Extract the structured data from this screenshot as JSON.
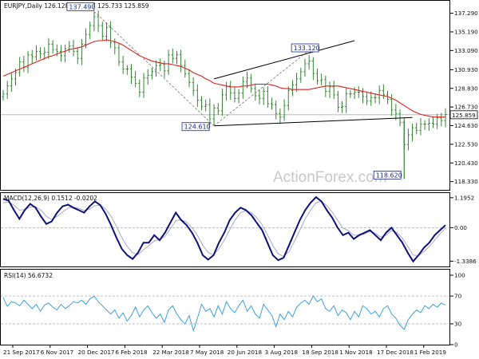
{
  "chart_data": [
    {
      "type": "candlestick",
      "header": "EURJPY,Daily  126.128 126.227 125.733 125.859",
      "ylim": [
        117.4,
        138.6
      ],
      "yticks": [
        "137.290",
        "135.190",
        "133.090",
        "130.930",
        "128.830",
        "126.730",
        "124.630",
        "122.530",
        "120.430",
        "118.330"
      ],
      "current_price": "125.859",
      "annotations": [
        {
          "text": "137.490",
          "date_index": 22
        },
        {
          "text": "133.120",
          "date_index": 74
        },
        {
          "text": "124.610",
          "date_index": 51
        },
        {
          "text": "118.620",
          "date_index": 97
        }
      ],
      "closes": [
        128.2,
        129.1,
        129.9,
        130.6,
        131.8,
        131.2,
        132.6,
        132.4,
        133.0,
        132.7,
        132.9,
        133.8,
        133.2,
        133.0,
        132.5,
        133.3,
        133.6,
        133.0,
        132.2,
        133.8,
        134.9,
        135.9,
        136.9,
        135.9,
        134.7,
        135.7,
        134.0,
        133.4,
        131.8,
        131.0,
        131.0,
        130.1,
        129.4,
        128.4,
        130.0,
        130.3,
        130.7,
        131.4,
        131.5,
        130.8,
        132.6,
        132.2,
        132.6,
        131.4,
        130.5,
        129.5,
        128.6,
        127.5,
        126.8,
        127.0,
        125.4,
        126.6,
        126.3,
        128.1,
        129.1,
        128.3,
        127.7,
        128.3,
        129.6,
        130.0,
        128.8,
        128.0,
        127.7,
        128.5,
        127.1,
        127.0,
        126.0,
        125.6,
        126.9,
        128.6,
        129.2,
        129.9,
        130.7,
        131.6,
        131.9,
        130.5,
        129.7,
        129.8,
        128.5,
        129.0,
        128.1,
        126.7,
        126.8,
        128.2,
        128.2,
        128.4,
        128.4,
        127.9,
        127.4,
        127.8,
        127.8,
        128.6,
        128.1,
        127.6,
        126.4,
        126.0,
        125.0,
        122.5,
        123.6,
        124.4,
        124.1,
        124.8,
        124.8,
        124.9,
        124.8,
        125.5,
        125.2,
        125.9
      ],
      "ma": [
        130.2,
        130.4,
        130.6,
        130.8,
        131.0,
        131.2,
        131.4,
        131.6,
        131.8,
        132.0,
        132.2,
        132.4,
        132.5,
        132.7,
        132.9,
        133.0,
        133.2,
        133.3,
        133.4,
        133.5,
        133.7,
        133.9,
        134.1,
        134.2,
        134.2,
        134.3,
        134.2,
        134.1,
        133.9,
        133.7,
        133.4,
        133.1,
        132.8,
        132.5,
        132.3,
        132.1,
        131.9,
        131.8,
        131.7,
        131.6,
        131.6,
        131.5,
        131.4,
        131.3,
        131.1,
        130.9,
        130.6,
        130.4,
        130.2,
        129.9,
        129.7,
        129.4,
        129.3,
        129.2,
        129.1,
        129.0,
        129.0,
        129.0,
        129.1,
        129.1,
        129.2,
        129.3,
        129.3,
        129.3,
        129.3,
        129.2,
        129.1,
        128.9,
        128.8,
        128.8,
        128.7,
        128.7,
        128.7,
        128.7,
        128.7,
        128.8,
        128.9,
        129.0,
        129.1,
        129.1,
        129.1,
        129.1,
        129.0,
        128.9,
        128.8,
        128.7,
        128.6,
        128.5,
        128.4,
        128.3,
        128.2,
        128.1,
        128.0,
        127.9,
        127.7,
        127.5,
        127.2,
        126.9,
        126.6,
        126.3,
        126.1,
        125.9,
        125.8,
        125.7,
        125.6,
        125.6,
        125.6,
        125.6
      ],
      "ma_color": "#e02020"
    },
    {
      "type": "line",
      "header": "MACD(12,26,9) 0.1512 -0.0202",
      "ylim": [
        -1.55,
        1.35
      ],
      "yticks": [
        "1.1952",
        "0.00",
        "-1.3386"
      ],
      "macd": [
        1.15,
        1.08,
        0.7,
        0.35,
        0.7,
        0.95,
        0.8,
        0.45,
        0.15,
        0.25,
        0.6,
        0.85,
        0.92,
        0.8,
        0.7,
        0.6,
        0.85,
        1.05,
        0.9,
        0.55,
        0.1,
        -0.4,
        -0.85,
        -1.1,
        -1.25,
        -1.0,
        -0.6,
        -0.6,
        -0.3,
        -0.5,
        -0.2,
        0.2,
        0.6,
        0.3,
        0.1,
        -0.2,
        -0.6,
        -1.1,
        -1.28,
        -1.1,
        -0.6,
        -0.2,
        0.3,
        0.6,
        0.8,
        0.7,
        0.5,
        0.2,
        -0.1,
        -0.6,
        -1.1,
        -1.3,
        -1.2,
        -0.7,
        -0.2,
        0.3,
        0.7,
        1.0,
        1.22,
        1.05,
        0.7,
        0.4,
        0.0,
        -0.3,
        -0.2,
        -0.45,
        -0.3,
        -0.2,
        -0.1,
        -0.3,
        -0.5,
        -0.2,
        0.0,
        -0.3,
        -0.6,
        -1.0,
        -1.35,
        -1.1,
        -0.8,
        -0.6,
        -0.3,
        -0.1,
        0.1
      ],
      "signal": [
        1.0,
        1.02,
        0.9,
        0.7,
        0.72,
        0.82,
        0.84,
        0.7,
        0.45,
        0.32,
        0.45,
        0.62,
        0.78,
        0.82,
        0.77,
        0.69,
        0.74,
        0.88,
        0.9,
        0.74,
        0.45,
        0.05,
        -0.4,
        -0.75,
        -1.0,
        -1.08,
        -0.88,
        -0.72,
        -0.52,
        -0.48,
        -0.35,
        -0.05,
        0.28,
        0.32,
        0.22,
        0.0,
        -0.3,
        -0.7,
        -1.0,
        -1.08,
        -0.85,
        -0.5,
        -0.08,
        0.3,
        0.6,
        0.68,
        0.6,
        0.4,
        0.12,
        -0.28,
        -0.72,
        -1.05,
        -1.15,
        -0.95,
        -0.55,
        -0.1,
        0.35,
        0.7,
        1.0,
        1.05,
        0.88,
        0.62,
        0.3,
        -0.02,
        -0.12,
        -0.3,
        -0.3,
        -0.25,
        -0.15,
        -0.22,
        -0.38,
        -0.3,
        -0.12,
        -0.2,
        -0.42,
        -0.75,
        -1.1,
        -1.12,
        -0.95,
        -0.75,
        -0.5,
        -0.25,
        -0.02
      ]
    },
    {
      "type": "line",
      "header": "RSI(14) 56.6732",
      "ylim": [
        0,
        100
      ],
      "yticks": [
        "100",
        "70",
        "30",
        "0"
      ],
      "rsi": [
        68,
        55,
        62,
        60,
        56,
        64,
        58,
        52,
        58,
        48,
        57,
        60,
        54,
        50,
        58,
        52,
        56,
        62,
        60,
        64,
        58,
        66,
        70,
        62,
        56,
        50,
        44,
        50,
        38,
        46,
        34,
        42,
        54,
        40,
        50,
        56,
        46,
        38,
        44,
        32,
        50,
        56,
        44,
        36,
        30,
        42,
        20,
        38,
        58,
        48,
        52,
        40,
        56,
        44,
        62,
        52,
        46,
        56,
        64,
        48,
        56,
        44,
        38,
        58,
        50,
        42,
        26,
        44,
        36,
        48,
        40,
        54,
        60,
        64,
        58,
        70,
        62,
        66,
        52,
        48,
        56,
        42,
        50,
        46,
        36,
        48,
        40,
        56,
        52,
        44,
        48,
        40,
        52,
        56,
        44,
        38,
        28,
        22,
        36,
        44,
        50,
        46,
        56,
        52,
        58,
        54,
        60,
        57
      ]
    }
  ],
  "x_labels": [
    "21 Sep 2017",
    "6 Nov 2017",
    "20 Dec 2017",
    "6 Feb 2018",
    "22 Mar 2018",
    "7 May 2018",
    "20 Jun 2018",
    "3 Aug 2018",
    "18 Sep 2018",
    "1 Nov 2018",
    "17 Dec 2018",
    "1 Feb 2019"
  ],
  "watermark": "ActionForex.com",
  "colors": {
    "candle": "#1e7a1e",
    "macd": "#10107a",
    "signal": "#a8a8c8",
    "rsi": "#2a9ad8",
    "trendline": "#000000",
    "ma": "#e02020"
  }
}
